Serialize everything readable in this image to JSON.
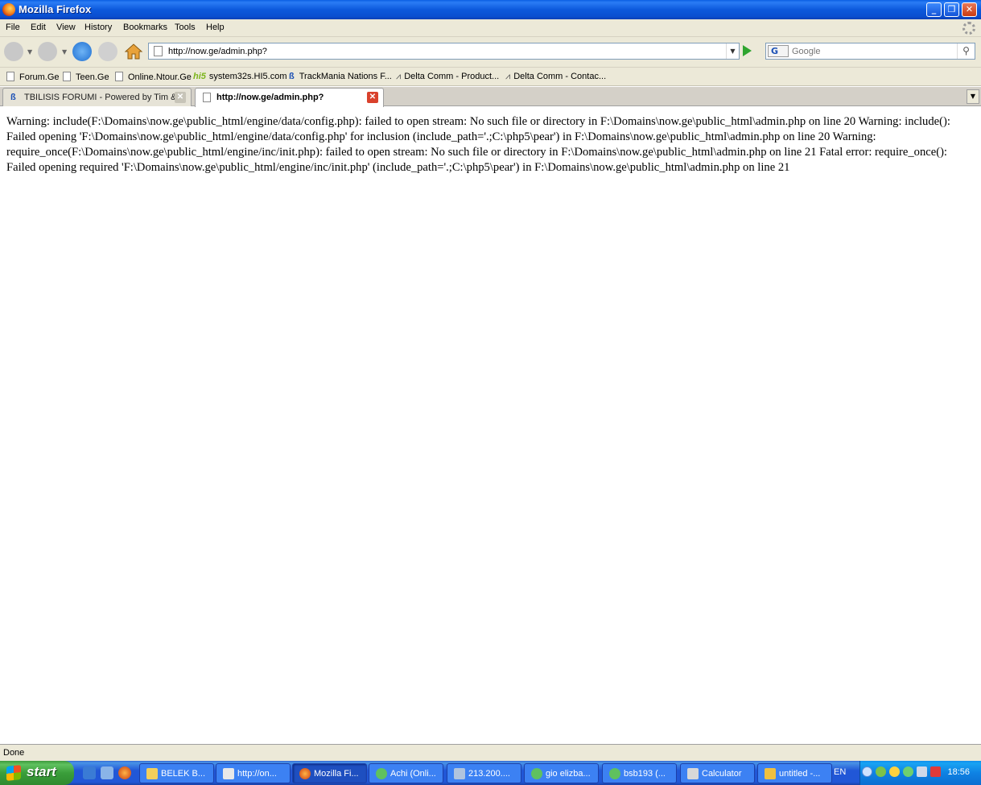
{
  "window": {
    "title": "Mozilla Firefox",
    "minimize": "_",
    "restore": "❐",
    "close": "✕"
  },
  "menu": [
    "File",
    "Edit",
    "View",
    "History",
    "Bookmarks",
    "Tools",
    "Help"
  ],
  "navigation": {
    "url": "http://now.ge/admin.php?",
    "search_placeholder": "Google",
    "search_engine": "G"
  },
  "bookmarks": [
    "Forum.Ge",
    "Teen.Ge",
    "Online.Ntour.Ge",
    "system32s.HI5.com",
    "TrackMania Nations F...",
    "Delta Comm - Product...",
    "Delta Comm - Contac..."
  ],
  "tabs": [
    {
      "label": "TBILISIS FORUMI - Powered by Tim & ...",
      "active": false
    },
    {
      "label": "http://now.ge/admin.php?",
      "active": true
    }
  ],
  "content": {
    "error_text": "Warning: include(F:\\Domains\\now.ge\\public_html/engine/data/config.php): failed to open stream: No such file or directory in F:\\Domains\\now.ge\\public_html\\admin.php on line 20 Warning: include(): Failed opening 'F:\\Domains\\now.ge\\public_html/engine/data/config.php' for inclusion (include_path='.;C:\\php5\\pear') in F:\\Domains\\now.ge\\public_html\\admin.php on line 20 Warning: require_once(F:\\Domains\\now.ge\\public_html/engine/inc/init.php): failed to open stream: No such file or directory in F:\\Domains\\now.ge\\public_html\\admin.php on line 21 Fatal error: require_once(): Failed opening required 'F:\\Domains\\now.ge\\public_html/engine/inc/init.php' (include_path='.;C:\\php5\\pear') in F:\\Domains\\now.ge\\public_html\\admin.php on line 21"
  },
  "status": {
    "text": "Done"
  },
  "taskbar": {
    "start": "start",
    "items": [
      "BELEK B...",
      "http://on...",
      "Mozilla Fi...",
      "Achi (Onli...",
      "213.200....",
      "gio elizba...",
      "bsb193 (...",
      "Calculator",
      "untitled -..."
    ],
    "active_index": 2,
    "language": "EN",
    "clock": "18:56"
  }
}
